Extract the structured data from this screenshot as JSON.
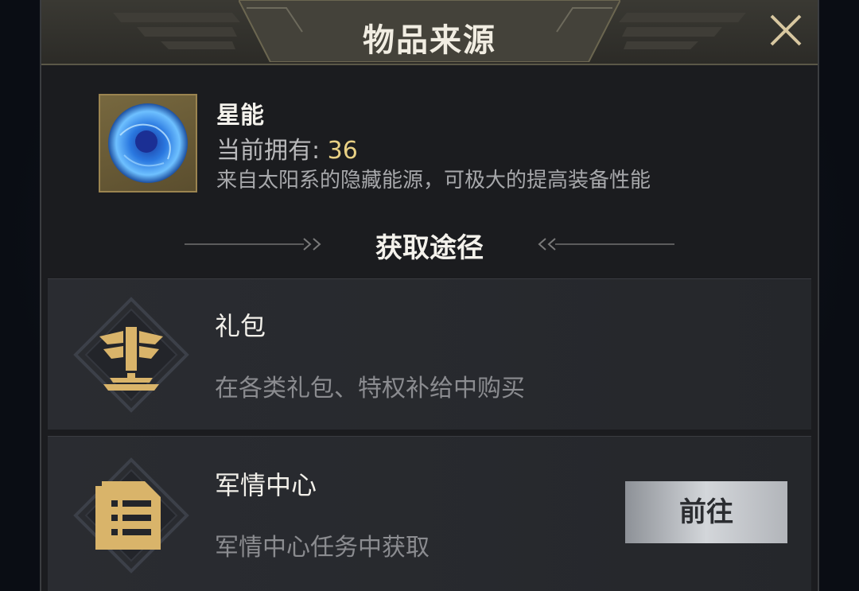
{
  "dialog": {
    "title": "物品来源"
  },
  "item": {
    "name": "星能",
    "owned_label": "当前拥有: ",
    "owned_value": "36",
    "description": "来自太阳系的隐藏能源，可极大的提高装备性能"
  },
  "sources": {
    "heading": "获取途径",
    "list": [
      {
        "title": "礼包",
        "description": "在各类礼包、特权补给中购买",
        "icon": "gift-pack-icon"
      },
      {
        "title": "军情中心",
        "description": "军情中心任务中获取",
        "icon": "document-icon",
        "button": "前往"
      }
    ]
  },
  "colors": {
    "accent_gold": "#d9b46a",
    "value_yellow": "#e8d084",
    "panel_bg": "#1b1c1f"
  }
}
